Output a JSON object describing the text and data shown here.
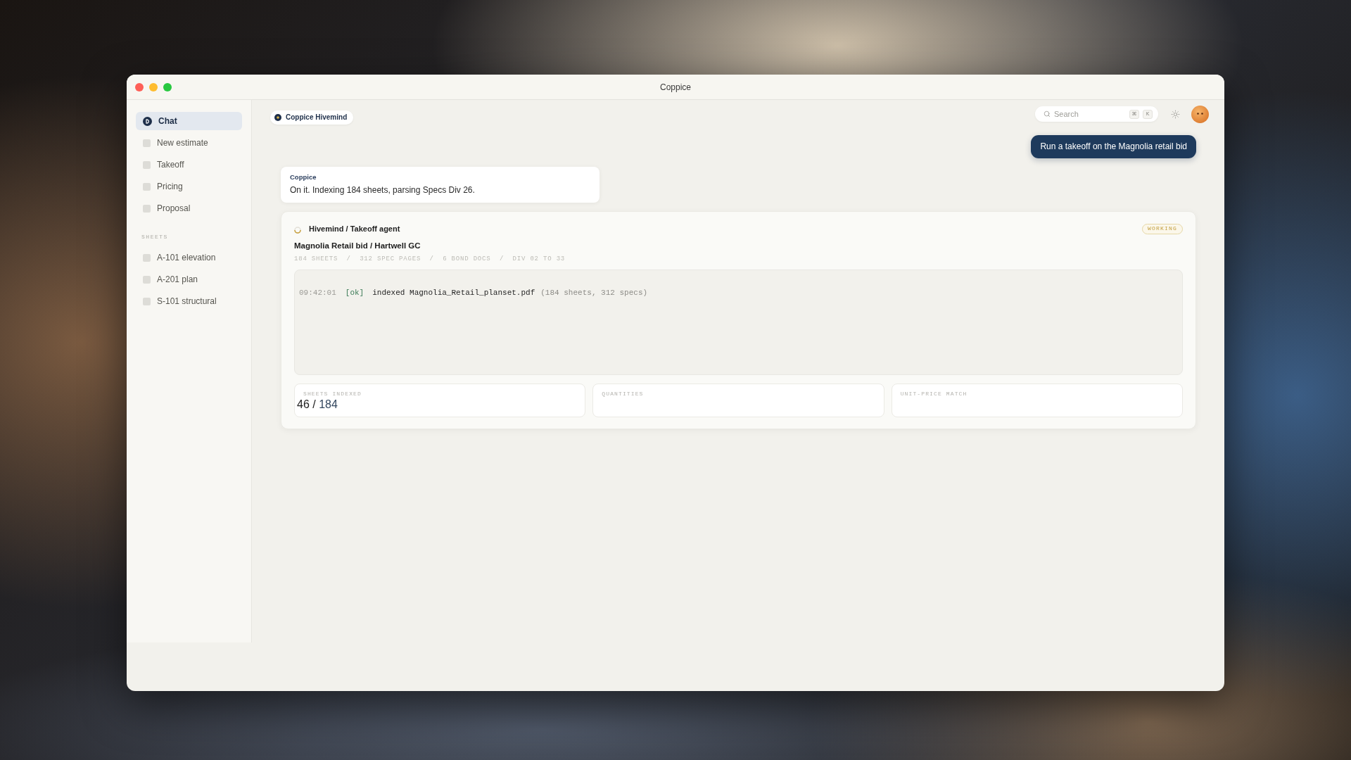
{
  "window": {
    "title": "Coppice"
  },
  "sidebar": {
    "nav": [
      {
        "label": "Chat",
        "selected": true
      },
      {
        "label": "New estimate",
        "selected": false
      },
      {
        "label": "Takeoff",
        "selected": false
      },
      {
        "label": "Pricing",
        "selected": false
      },
      {
        "label": "Proposal",
        "selected": false
      }
    ],
    "sections": [
      {
        "title": "SHEETS",
        "items": [
          {
            "label": "A-101 elevation",
            "selected": false
          },
          {
            "label": "A-201 plan",
            "selected": false
          },
          {
            "label": "S-101 structural",
            "selected": false
          }
        ]
      }
    ]
  },
  "header": {
    "workspace": {
      "label": "Coppice Hivemind"
    },
    "search": {
      "placeholder": "Search",
      "keys": [
        "⌘",
        "K"
      ]
    }
  },
  "messages": [
    {
      "kind": "user",
      "text": "Run a takeoff on the Magnolia retail bid"
    },
    {
      "kind": "assistant",
      "author": "Coppice",
      "text": "On it. Indexing 184 sheets, parsing Specs Div 26."
    }
  ],
  "agent_card": {
    "title": "Hivemind / Takeoff agent",
    "status": {
      "label": "WORKING",
      "kind": "working"
    },
    "project": "Magnolia Retail bid / Hartwell GC",
    "meta": "184 SHEETS  /  312 SPEC PAGES  /  6 BOND DOCS  /  DIV 02 TO 33",
    "log": [
      {
        "time": "09:42:01",
        "tag": "[ok]",
        "kind": "ok",
        "message": "indexed Magnolia_Retail_planset.pdf",
        "detail": "(184 sheets, 312 specs)"
      }
    ],
    "stats": [
      {
        "label": "SHEETS INDEXED",
        "value": "46 /",
        "total": "184"
      },
      {
        "label": "QUANTITIES"
      },
      {
        "label": "UNIT-PRICE MATCH"
      }
    ]
  }
}
